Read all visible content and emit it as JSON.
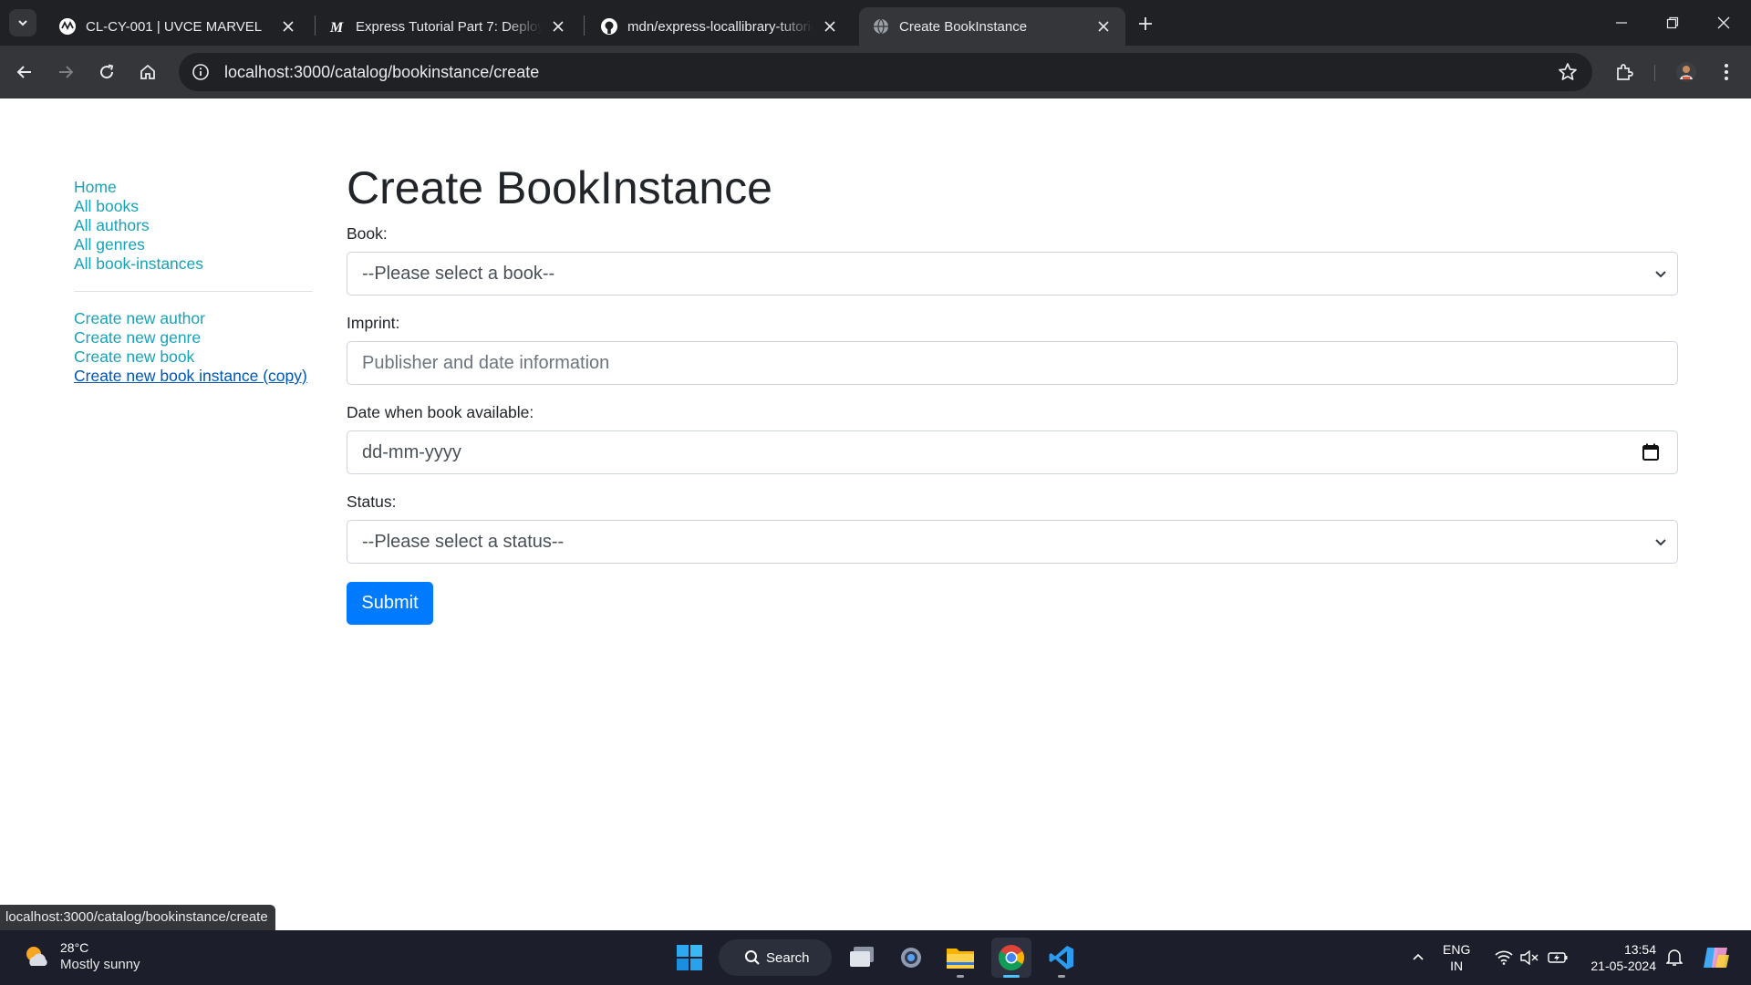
{
  "browser": {
    "tabs": [
      {
        "title": "CL-CY-001 | UVCE MARVEL",
        "icon": "marvel-logo-icon"
      },
      {
        "title": "Express Tutorial Part 7: Deploying",
        "icon": "mdn-logo-icon"
      },
      {
        "title": "mdn/express-locallibrary-tutorial",
        "icon": "github-icon"
      },
      {
        "title": "Create BookInstance",
        "icon": "globe-icon",
        "active": true
      }
    ],
    "url": "localhost:3000/catalog/bookinstance/create",
    "status_url": "localhost:3000/catalog/bookinstance/create"
  },
  "sidebar": {
    "group1": [
      {
        "label": "Home"
      },
      {
        "label": "All books"
      },
      {
        "label": "All authors"
      },
      {
        "label": "All genres"
      },
      {
        "label": "All book-instances"
      }
    ],
    "group2": [
      {
        "label": "Create new author"
      },
      {
        "label": "Create new genre"
      },
      {
        "label": "Create new book"
      },
      {
        "label": "Create new book instance (copy)"
      }
    ]
  },
  "form": {
    "heading": "Create BookInstance",
    "book_label": "Book:",
    "book_value": "--Please select a book--",
    "imprint_label": "Imprint:",
    "imprint_placeholder": "Publisher and date information",
    "date_label": "Date when book available:",
    "date_placeholder": "dd-mm-yyyy",
    "status_label": "Status:",
    "status_value": "--Please select a status--",
    "submit_label": "Submit"
  },
  "taskbar": {
    "weather_temp": "28°C",
    "weather_desc": "Mostly sunny",
    "search_label": "Search",
    "lang_1": "ENG",
    "lang_2": "IN",
    "time": "13:54",
    "date": "21-05-2024"
  },
  "colors": {
    "link": "#17a2b8",
    "visited_link": "#0056b3",
    "primary": "#007bff",
    "chrome_dark": "#202124",
    "chrome_toolbar": "#35363a",
    "taskbar": "#1c1f2b"
  }
}
